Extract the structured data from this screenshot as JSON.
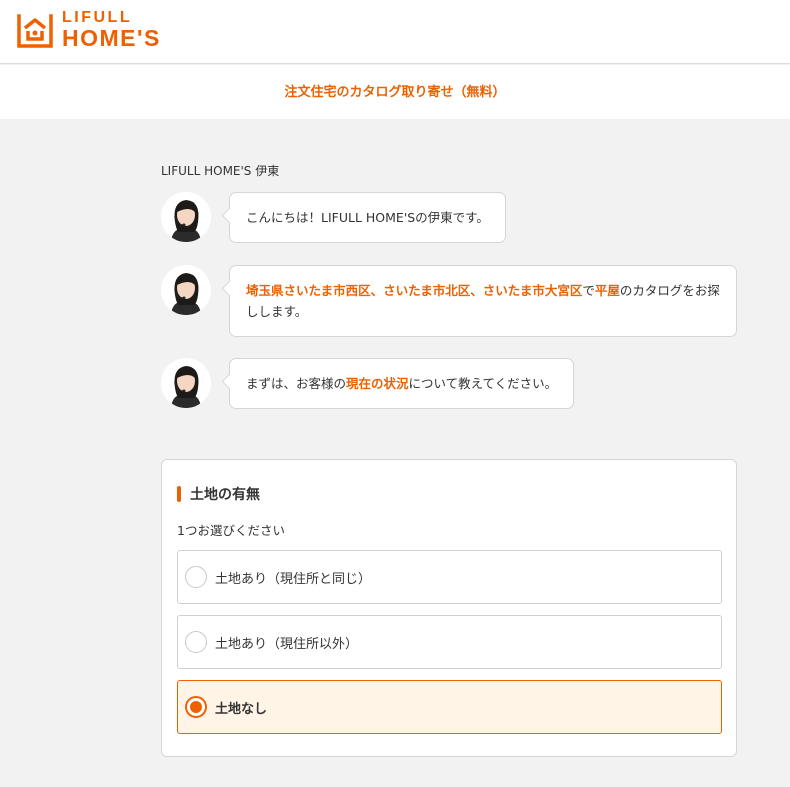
{
  "header": {
    "logo_top": "LIFULL",
    "logo_bottom": "HOME'S",
    "brand_color": "#ed6103"
  },
  "subheader": {
    "title": "注文住宅のカタログ取り寄せ（無料）"
  },
  "chat": {
    "agent_name": "LIFULL HOME'S 伊東",
    "messages": [
      {
        "segments": [
          {
            "text": "こんにちは！LIFULL HOME'Sの伊東です。"
          }
        ]
      },
      {
        "segments": [
          {
            "text": "埼玉県さいたま市西区、さいたま市北区、さいたま市大宮区",
            "hl": true
          },
          {
            "text": "で"
          },
          {
            "text": "平屋",
            "hl": true
          },
          {
            "text": "のカタログをお探しします。"
          }
        ]
      },
      {
        "segments": [
          {
            "text": "まずは、お客様の"
          },
          {
            "text": "現在の状況",
            "hl": true
          },
          {
            "text": "について教えてください。"
          }
        ]
      }
    ]
  },
  "question": {
    "title": "土地の有無",
    "note": "1つお選びください",
    "options": [
      {
        "label": "土地あり（現住所と同じ）",
        "selected": false
      },
      {
        "label": "土地あり（現住所以外）",
        "selected": false
      },
      {
        "label": "土地なし",
        "selected": true
      }
    ]
  }
}
